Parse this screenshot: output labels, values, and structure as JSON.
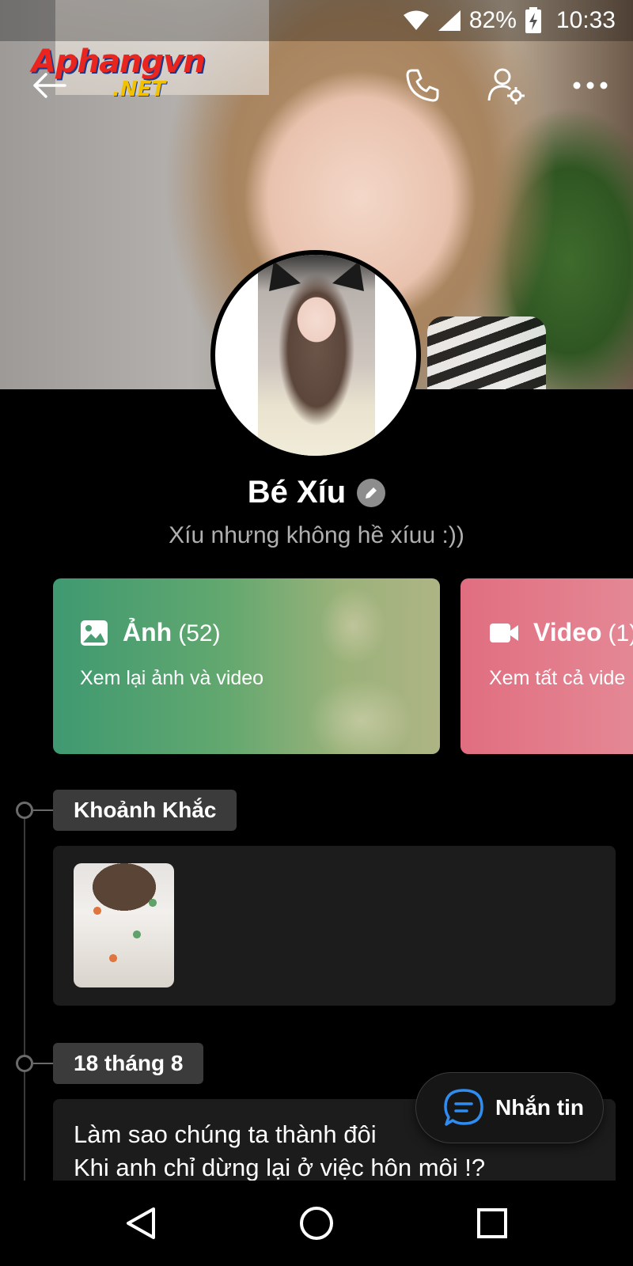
{
  "status_bar": {
    "battery": "82%",
    "time": "10:33",
    "icons": [
      "wifi-icon",
      "cell-signal-icon",
      "battery-charging-icon"
    ]
  },
  "watermark": {
    "line1": "Aphangvn",
    "line2": ".NET"
  },
  "top_actions": [
    "back-arrow-icon",
    "phone-icon",
    "user-settings-icon",
    "more-icon"
  ],
  "profile": {
    "name": "Bé Xíu",
    "bio": "Xíu nhưng không hề xíuu :))"
  },
  "albums": [
    {
      "title": "Ảnh",
      "count": "(52)",
      "subtitle": "Xem lại ảnh và video",
      "icon": "image-icon",
      "color": "#4a9e73"
    },
    {
      "title": "Video",
      "count": "(1)",
      "subtitle": "Xem tất cả vide",
      "icon": "video-camera-icon",
      "color": "#e27485"
    }
  ],
  "timeline": [
    {
      "label": "Khoảnh Khắc"
    },
    {
      "label": "18 tháng 8",
      "text": "Làm sao chúng ta thành đôi\nKhi anh chỉ dừng lại ở việc hôn môi !?"
    }
  ],
  "message_button": {
    "label": "Nhắn tin",
    "icon": "chat-bubble-icon",
    "accent": "#2f8cf0"
  },
  "nav": [
    "back-triangle-icon",
    "home-circle-icon",
    "recents-square-icon"
  ]
}
